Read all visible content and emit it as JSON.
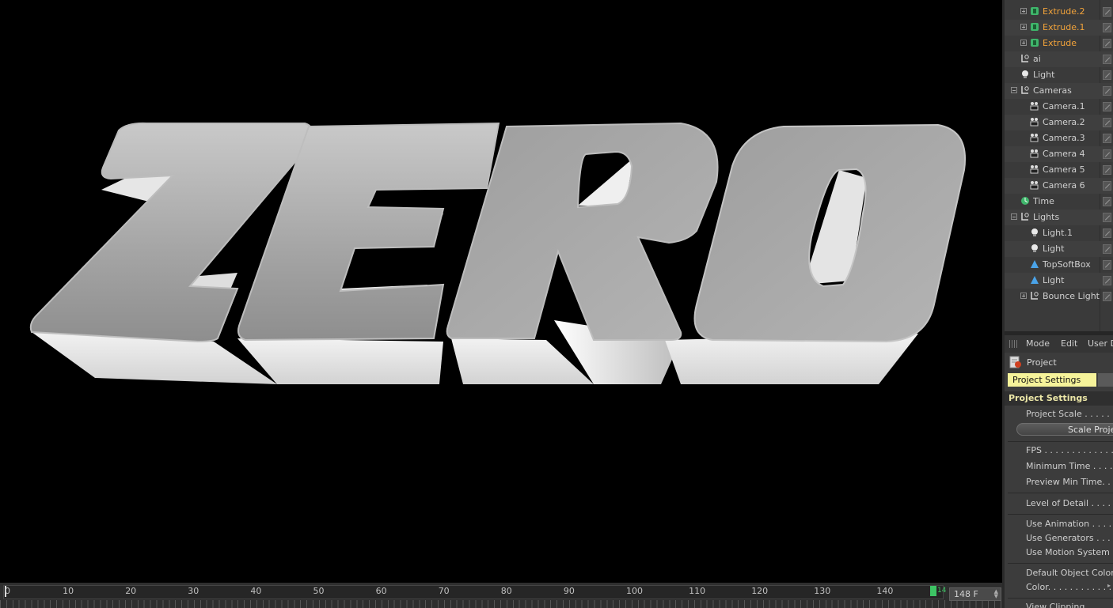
{
  "viewport": {
    "text": "ZERO"
  },
  "object_manager": {
    "items": [
      {
        "label": "Extrude.2",
        "icon": "extrude-icon",
        "expander": "plus",
        "highlight": true
      },
      {
        "label": "Extrude.1",
        "icon": "extrude-icon",
        "expander": "plus",
        "highlight": true
      },
      {
        "label": "Extrude",
        "icon": "extrude-icon",
        "expander": "plus",
        "highlight": true
      },
      {
        "label": "ai",
        "icon": "null-icon",
        "expander": "none"
      },
      {
        "label": "Light",
        "icon": "light-bulb-icon",
        "expander": "none"
      },
      {
        "label": "Cameras",
        "icon": "null-icon",
        "expander": "minus"
      },
      {
        "label": "Camera.1",
        "icon": "camera-icon",
        "expander": "none"
      },
      {
        "label": "Camera.2",
        "icon": "camera-icon",
        "expander": "none"
      },
      {
        "label": "Camera.3",
        "icon": "camera-icon",
        "expander": "none"
      },
      {
        "label": "Camera 4",
        "icon": "camera-icon",
        "expander": "none"
      },
      {
        "label": "Camera 5",
        "icon": "camera-icon",
        "expander": "none"
      },
      {
        "label": "Camera 6",
        "icon": "camera-icon",
        "expander": "none"
      },
      {
        "label": "Time",
        "icon": "time-icon",
        "expander": "none"
      },
      {
        "label": "Lights",
        "icon": "null-icon",
        "expander": "minus"
      },
      {
        "label": "Light.1",
        "icon": "light-bulb-icon",
        "expander": "none"
      },
      {
        "label": "Light",
        "icon": "light-bulb-icon",
        "expander": "none"
      },
      {
        "label": "TopSoftBox",
        "icon": "area-light-icon",
        "expander": "none"
      },
      {
        "label": "Light",
        "icon": "area-light-icon",
        "expander": "none"
      },
      {
        "label": "Bounce Light",
        "icon": "null-icon",
        "expander": "plus"
      }
    ]
  },
  "attributes": {
    "menu": [
      "Mode",
      "Edit",
      "User D"
    ],
    "object_name": "Project",
    "tab": "Project Settings",
    "section": "Project Settings",
    "project_scale": "Project Scale . . . . . . .",
    "scale_button": "Scale Project",
    "fps": "FPS  . . . . . . . . . . . . . . .",
    "min_time": "Minimum Time . . . . . .",
    "preview_min_time": "Preview Min Time. . . . .",
    "level_of_detail": "Level of Detail  . . . . .",
    "use_animation": "Use Animation . . . . . .",
    "use_generators": "Use Generators . . . . .",
    "use_motion_system": "Use Motion System",
    "default_object_color": "Default Object Color",
    "color": "Color. . . . . . . . . . . . .",
    "view_clipping": "View Clipping"
  },
  "timeline": {
    "ticks": [
      "0",
      "10",
      "20",
      "30",
      "40",
      "50",
      "60",
      "70",
      "80",
      "90",
      "100",
      "110",
      "120",
      "130",
      "140"
    ],
    "end_marker": "14",
    "frame_field": "148 F",
    "colors": {
      "end_marker": "#3dc464"
    }
  },
  "colors": {
    "highlight": "#f2a33a",
    "tab_bg": "#f6f39a",
    "section_text": "#ece7a7"
  }
}
